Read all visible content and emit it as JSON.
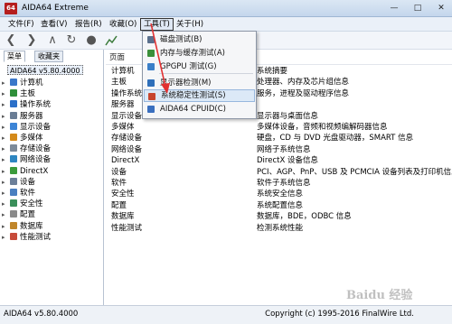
{
  "window": {
    "icon_text": "64",
    "title": "AIDA64 Extreme",
    "minimize": "—",
    "maximize": "□",
    "close": "✕"
  },
  "menubar": [
    "文件(F)",
    "查看(V)",
    "报告(R)",
    "收藏(O)",
    "工具(T)",
    "关于(H)"
  ],
  "toolbar": {
    "icons": [
      "back-icon",
      "forward-icon",
      "up-icon",
      "refresh-icon",
      "user-icon",
      "chart-icon"
    ]
  },
  "left_tabs": [
    "菜单",
    "收藏夹"
  ],
  "tree": {
    "root": "AIDA64 v5.80.4000",
    "items": [
      {
        "label": "计算机",
        "color": "#3a77c9"
      },
      {
        "label": "主板",
        "color": "#2f8f3a"
      },
      {
        "label": "操作系统",
        "color": "#2a6fc8"
      },
      {
        "label": "服务器",
        "color": "#6a7d95"
      },
      {
        "label": "显示设备",
        "color": "#3c84d6"
      },
      {
        "label": "多媒体",
        "color": "#d48a1a"
      },
      {
        "label": "存储设备",
        "color": "#7c8a99"
      },
      {
        "label": "网络设备",
        "color": "#2e86c1"
      },
      {
        "label": "DirectX",
        "color": "#3b9b3b"
      },
      {
        "label": "设备",
        "color": "#6b7f99"
      },
      {
        "label": "软件",
        "color": "#4a7fc0"
      },
      {
        "label": "安全性",
        "color": "#3a8f5a"
      },
      {
        "label": "配置",
        "color": "#8a8a8a"
      },
      {
        "label": "数据库",
        "color": "#c0862a"
      },
      {
        "label": "性能测试",
        "color": "#c74b3a"
      }
    ]
  },
  "list": {
    "header_page": "页面",
    "rows": [
      {
        "name": "计算机",
        "desc": "系统摘要"
      },
      {
        "name": "主板",
        "desc": "处理器、内存及芯片组信息"
      },
      {
        "name": "操作系统",
        "desc": "服务，进程及驱动程序信息"
      },
      {
        "name": "服务器",
        "desc": ""
      },
      {
        "name": "显示设备",
        "desc": "显示器与桌面信息"
      },
      {
        "name": "多媒体",
        "desc": "多媒体设备，音频和视频编解码器信息"
      },
      {
        "name": "存储设备",
        "desc": "硬盘，CD 与 DVD 光盘驱动器，SMART 信息"
      },
      {
        "name": "网络设备",
        "desc": "网络子系统信息"
      },
      {
        "name": "DirectX",
        "desc": "DirectX 设备信息"
      },
      {
        "name": "设备",
        "desc": "PCI、AGP、PnP、USB 及 PCMCIA 设备列表及打印机信息"
      },
      {
        "name": "软件",
        "desc": "软件子系统信息"
      },
      {
        "name": "安全性",
        "desc": "系统安全信息"
      },
      {
        "name": "配置",
        "desc": "系统配置信息"
      },
      {
        "name": "数据库",
        "desc": "数据库，BDE，ODBC 信息"
      },
      {
        "name": "性能测试",
        "desc": "检测系统性能"
      }
    ]
  },
  "tools_menu": {
    "items": [
      {
        "label": "磁盘测试(B)",
        "icon_color": "#5a6f8c"
      },
      {
        "label": "内存与缓存测试(A)",
        "icon_color": "#3a8f3a"
      },
      {
        "label": "GPGPU 测试(G)",
        "icon_color": "#3a7fc8"
      },
      {
        "label": "显示器检测(M)",
        "icon_color": "#2e6fba"
      },
      {
        "label": "系统稳定性测试(S)",
        "icon_color": "#c7452f",
        "highlighted": true
      },
      {
        "label": "AIDA64 CPUID(C)",
        "icon_color": "#3a6fbf"
      }
    ]
  },
  "status": {
    "version": "AIDA64 v5.80.4000",
    "copyright": "Copyright (c) 1995-2016 FinalWire Ltd."
  },
  "watermark": "Baidu 经验",
  "colors": {
    "annotation_arrow": "#e23030"
  }
}
